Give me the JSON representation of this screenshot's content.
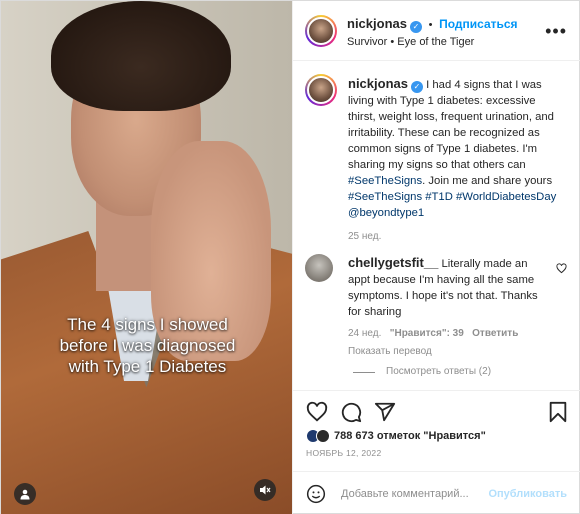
{
  "media": {
    "caption_line1": "The 4 signs I showed",
    "caption_line2": "before I was diagnosed",
    "caption_line3": "with Type 1 Diabetes"
  },
  "header": {
    "username": "nickjonas",
    "follow_label": "Подписаться",
    "separator": "•",
    "audio": "Survivor • Eye of the Tiger"
  },
  "post": {
    "username": "nickjonas",
    "text_plain": "I had 4 signs that I was living with Type 1 diabetes: excessive thirst, weight loss, frequent urination, and irritability. These can be recognized as common signs of Type 1 diabetes. I'm sharing my signs so that others can ",
    "tag1": "#SeeTheSigns",
    "text_mid": ". Join me and share yours ",
    "tag2": "#SeeTheSigns",
    "tag3": "#T1D",
    "tag4": "#WorldDiabetesDay",
    "tag5": "@beyondtype1",
    "time": "25 нед."
  },
  "comment": {
    "username": "chellygetsfit__",
    "text": "Literally made an appt because I'm having all the same symptoms. I hope it's not that. Thanks for sharing",
    "time": "24 нед.",
    "likes": "\"Нравится\": 39",
    "reply": "Ответить",
    "translate": "Показать перевод",
    "view_replies": "Посмотреть ответы (2)"
  },
  "actions": {
    "likes": "788 673 отметок \"Нравится\"",
    "date": "НОЯБРЬ 12, 2022"
  },
  "composer": {
    "placeholder": "Добавьте комментарий...",
    "publish": "Опубликовать"
  },
  "colors": {
    "accent": "#0095f6",
    "hashtag": "#00376b",
    "muted": "#8e8e8e"
  }
}
